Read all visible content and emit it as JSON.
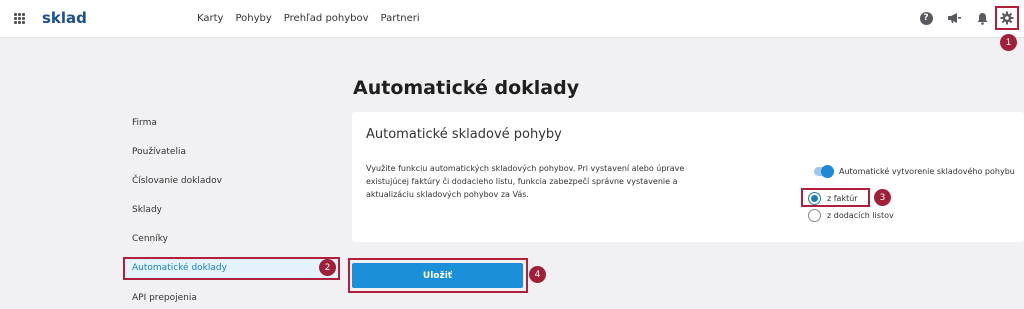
{
  "app": {
    "brand": "sklad"
  },
  "nav": {
    "items": [
      "Karty",
      "Pohyby",
      "Prehľad pohybov",
      "Partneri"
    ]
  },
  "header": {
    "help_symbol": "?"
  },
  "page": {
    "title": "Automatické doklady"
  },
  "sidebar": {
    "items": [
      "Firma",
      "Používatelia",
      "Číslovanie dokladov",
      "Sklady",
      "Cenníky",
      "Automatické doklady",
      "API prepojenia"
    ],
    "active": "Automatické doklady"
  },
  "card": {
    "title": "Automatické skladové pohyby",
    "description": "Využite funkciu automatických skladových pohybov. Pri vystavení alebo úprave existujúcej faktúry či dodacieho listu, funkcia zabezpečí správne vystavenie a aktualizáciu skladových pohybov za Vás.",
    "toggle_label": "Automatické vytvorenie skladového pohybu",
    "toggle_on": true,
    "radio_options": [
      "z faktúr",
      "z dodacích listov"
    ],
    "radio_selected": "z faktúr"
  },
  "actions": {
    "save_label": "Uložiť"
  },
  "annotations": [
    "1",
    "2",
    "3",
    "4"
  ],
  "colors": {
    "accent": "#1b8fd8",
    "brand": "#1d4f91",
    "highlight": "#b11f3b",
    "badge": "#a0203a"
  },
  "icons": [
    "apps-grid-icon",
    "help-icon",
    "megaphone-icon",
    "bell-icon",
    "gear-icon"
  ]
}
